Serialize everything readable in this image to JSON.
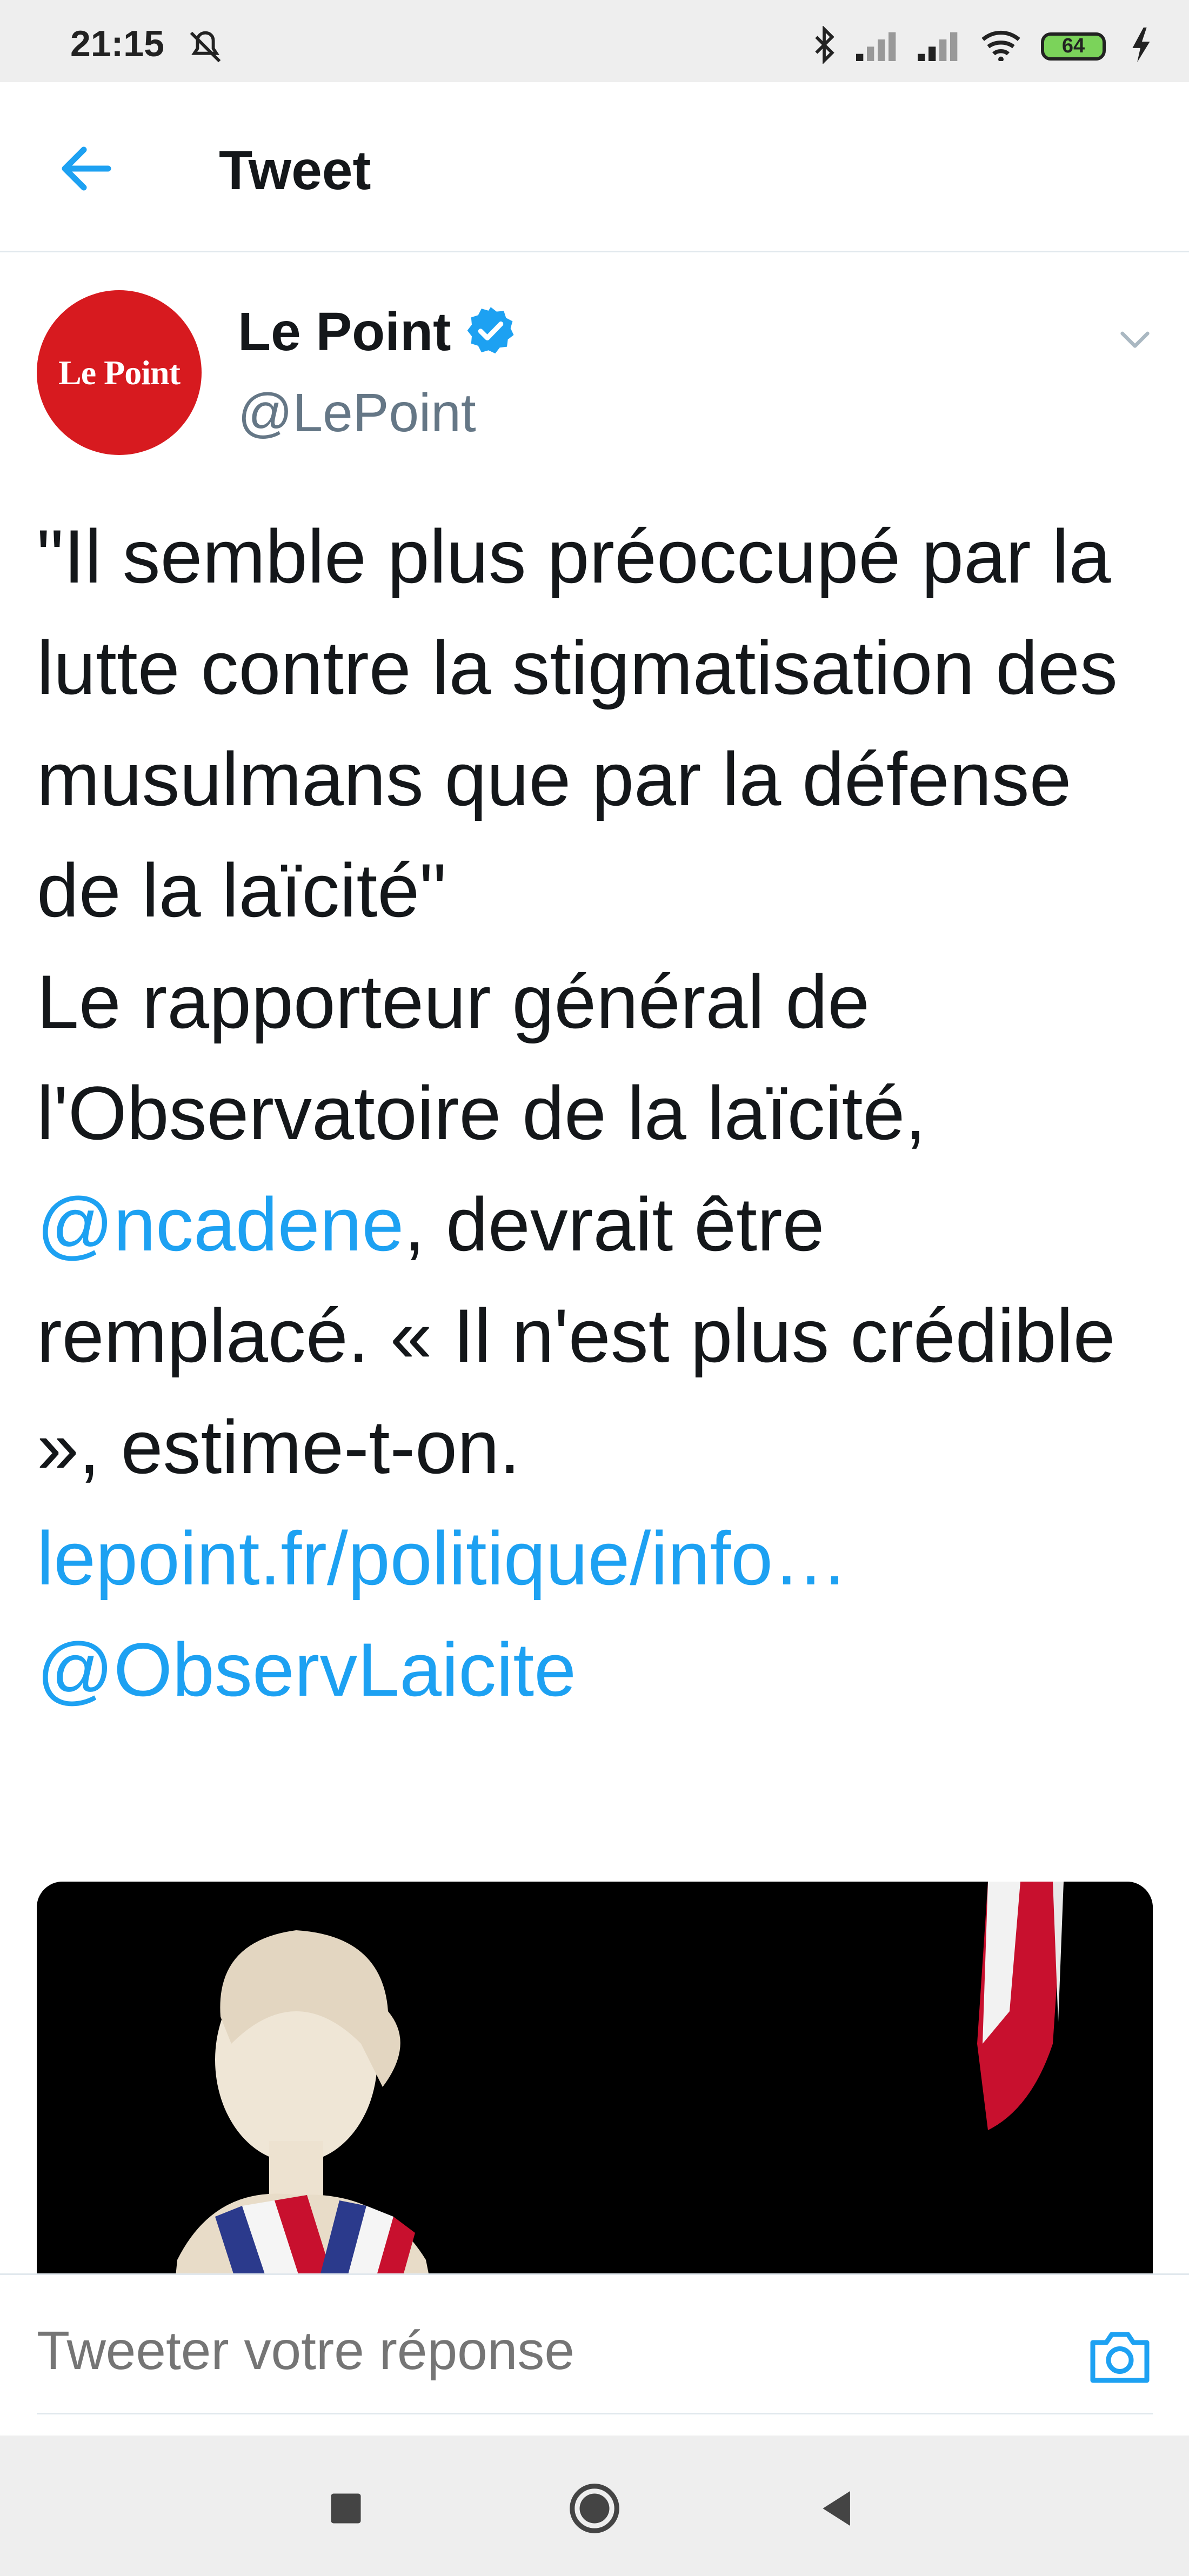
{
  "status_bar": {
    "time": "21:15",
    "battery": "64",
    "icons": [
      "mute-icon",
      "bluetooth-icon",
      "signal-icon",
      "signal-roaming-icon",
      "wifi-icon",
      "battery-icon",
      "charging-icon"
    ]
  },
  "header": {
    "title": "Tweet",
    "back_icon": "arrow-left-icon"
  },
  "tweet": {
    "avatar_text": "Le Point",
    "display_name": "Le Point",
    "handle": "@LePoint",
    "verified": true,
    "text_quote": "\"Il semble plus préoccupé par la lutte contre la stigmatisation des musulmans que par la défense de la laïcité\"",
    "text_body_1": "Le rapporteur général de l'Observatoire de la laïcité, ",
    "mention_1": "@ncadene",
    "text_body_2": ", devrait être remplacé. « Il n'est plus crédible », estime-t-on.",
    "link": "lepoint.fr/politique/info…",
    "mention_2": "@ObservLaicite"
  },
  "reply": {
    "placeholder": "Tweeter votre réponse",
    "camera_icon": "camera-icon"
  },
  "nav": {
    "icons": [
      "recents-square-icon",
      "home-circle-icon",
      "back-triangle-icon"
    ]
  },
  "colors": {
    "accent": "#1da1f2",
    "text": "#14171a",
    "secondary": "#657786",
    "avatar_bg": "#d71a1f"
  }
}
